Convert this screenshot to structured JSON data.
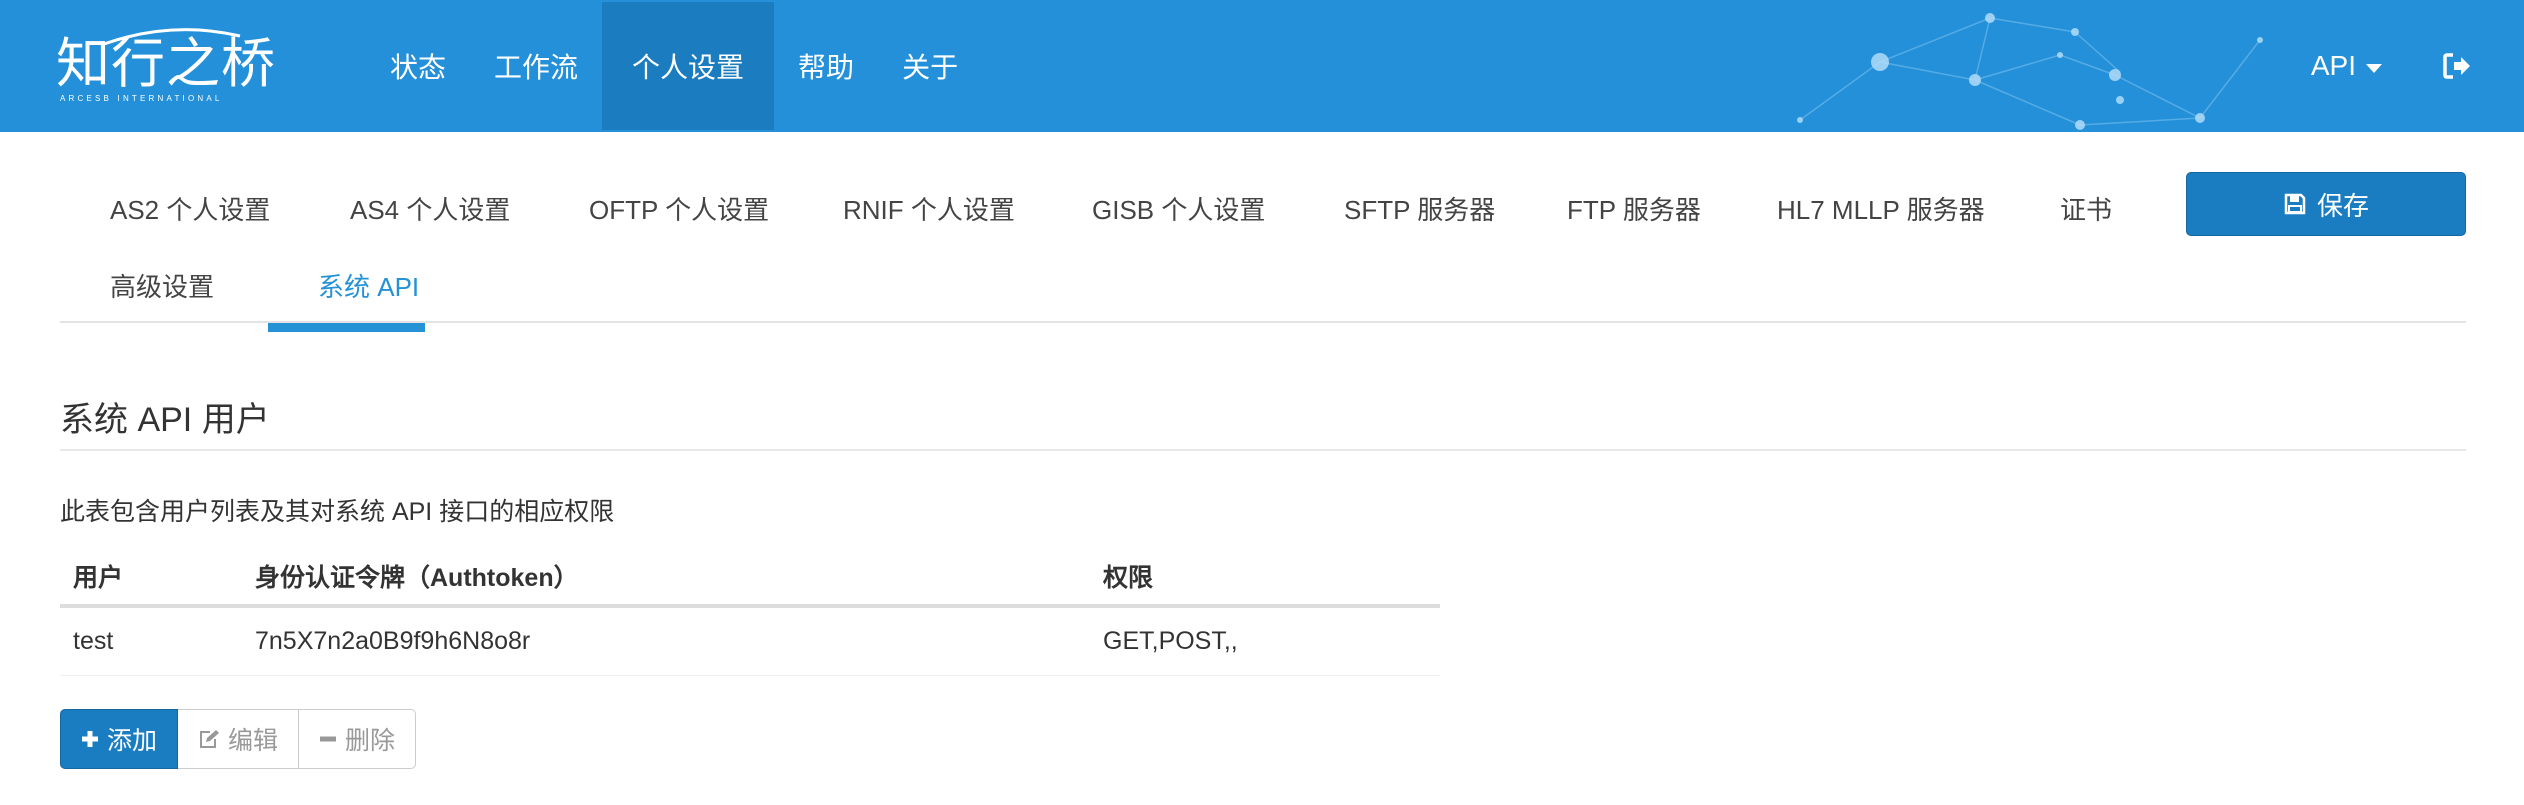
{
  "brand": {
    "title": "知行之桥",
    "subtitle": "ARCESB INTERNATIONAL"
  },
  "nav": {
    "items": [
      {
        "label": "状态"
      },
      {
        "label": "工作流"
      },
      {
        "label": "个人设置",
        "active": true
      },
      {
        "label": "帮助"
      },
      {
        "label": "关于"
      }
    ],
    "user_menu_label": "API",
    "logout_icon": "sign-out-icon"
  },
  "tabs": {
    "items": [
      {
        "label": "AS2 个人设置"
      },
      {
        "label": "AS4 个人设置"
      },
      {
        "label": "OFTP 个人设置"
      },
      {
        "label": "RNIF 个人设置"
      },
      {
        "label": "GISB 个人设置"
      },
      {
        "label": "SFTP 服务器"
      },
      {
        "label": "FTP 服务器"
      },
      {
        "label": "HL7 MLLP 服务器"
      },
      {
        "label": "证书"
      },
      {
        "label": "高级设置"
      },
      {
        "label": "系统 API",
        "active": true
      }
    ],
    "save_label": "保存",
    "save_icon": "floppy-disk-icon"
  },
  "section": {
    "title": "系统 API 用户",
    "description": "此表包含用户列表及其对系统 API 接口的相应权限"
  },
  "table": {
    "headers": [
      "用户",
      "身份认证令牌（Authtoken）",
      "权限"
    ],
    "rows": [
      [
        "test",
        "7n5X7n2a0B9f9h6N8o8r",
        "GET,POST,,"
      ]
    ]
  },
  "actions": {
    "add_label": "添加",
    "edit_label": "编辑",
    "delete_label": "删除"
  },
  "colors": {
    "navbar": "#2390d9",
    "navbar_active": "#1b7cbf",
    "primary_button": "#1a7cc1",
    "active_tab": "#2592d6"
  }
}
